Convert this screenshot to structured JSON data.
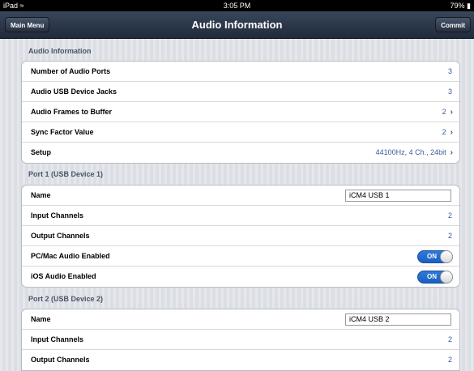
{
  "status_bar": {
    "device": "iPad",
    "time": "3:05 PM",
    "battery": "79%"
  },
  "nav": {
    "left_button": "Main Menu",
    "title": "Audio Information",
    "right_button": "Commit"
  },
  "audio_info": {
    "header": "Audio Information",
    "rows": [
      {
        "label": "Number of Audio Ports",
        "value": "3"
      },
      {
        "label": "Audio USB Device Jacks",
        "value": "3"
      },
      {
        "label": "Audio Frames to Buffer",
        "value": "2"
      },
      {
        "label": "Sync Factor Value",
        "value": "2"
      },
      {
        "label": "Setup",
        "value": "44100Hz, 4 Ch., 24bit"
      }
    ]
  },
  "port1": {
    "header": "Port 1 (USB Device 1)",
    "name_label": "Name",
    "name_value": "iCM4 USB 1",
    "input_channels_label": "Input Channels",
    "input_channels": "2",
    "output_channels_label": "Output Channels",
    "output_channels": "2",
    "pcmac_label": "PC/Mac Audio Enabled",
    "pcmac_toggle": "ON",
    "ios_label": "iOS Audio Enabled",
    "ios_toggle": "ON"
  },
  "port2": {
    "header": "Port 2 (USB Device 2)",
    "name_label": "Name",
    "name_value": "iCM4 USB 2",
    "input_channels_label": "Input Channels",
    "input_channels": "2",
    "output_channels_label": "Output Channels",
    "output_channels": "2"
  },
  "icons": {
    "chevron": "chevron-right-icon",
    "wifi": "wifi-icon",
    "battery": "battery-icon"
  }
}
